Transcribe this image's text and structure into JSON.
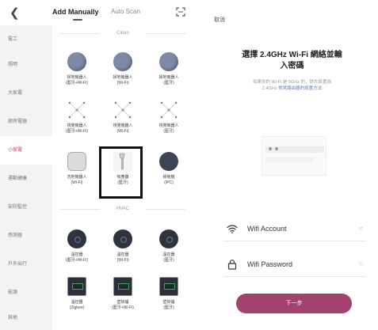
{
  "left": {
    "back_icon": "chevron-left-icon",
    "tabs": [
      {
        "label": "Add Manually",
        "active": true
      },
      {
        "label": "Auto Scan",
        "active": false
      }
    ],
    "scan_icon": "scan-frame-icon",
    "sidebar": [
      "電工",
      "照明",
      "大家電",
      "廚房電器",
      "小家電",
      "運動健康",
      "安防監控",
      "感測器",
      "戶外出行",
      "能源",
      "其他"
    ],
    "active_sidebar_index": 4,
    "sections": [
      {
        "title": "Clean",
        "devices": [
          {
            "label": "掃地機器人\n(藍牙+Wi-Fi)",
            "icon": "robot-vacuum-icon"
          },
          {
            "label": "掃地機器人\n(Wi-Fi)",
            "icon": "robot-vacuum-icon"
          },
          {
            "label": "掃地機器人\n(藍牙)",
            "icon": "robot-vacuum-icon"
          },
          {
            "label": "視覺機器人\n(藍牙+Wi-Fi)",
            "icon": "vision-robot-icon"
          },
          {
            "label": "視覺機器人\n(Wi-Fi)",
            "icon": "vision-robot-icon"
          },
          {
            "label": "視覺機器人\n(藍牙)",
            "icon": "vision-robot-icon"
          },
          {
            "label": "洗地機器人\n(Wi-Fi)",
            "icon": "mop-robot-icon"
          },
          {
            "label": "吸塵器\n(藍牙)",
            "icon": "handheld-vacuum-icon",
            "highlighted": true
          },
          {
            "label": "掃拖機\n(IPC)",
            "icon": "robot-vacuum-icon"
          }
        ]
      },
      {
        "title": "HVAC",
        "devices": [
          {
            "label": "溫控器\n(藍牙+Wi-Fi)",
            "icon": "thermostat-icon"
          },
          {
            "label": "溫控器\n(Wi-Fi)",
            "icon": "thermostat-icon"
          },
          {
            "label": "溫控器\n(藍牙)",
            "icon": "thermostat-icon"
          },
          {
            "label": "溫控器\n(Zigbee)",
            "icon": "thermostat-display-icon"
          },
          {
            "label": "壁掛爐\n(藍牙+Wi-Fi)",
            "icon": "thermostat-display-icon"
          },
          {
            "label": "壁掛爐\n(藍牙)",
            "icon": "thermostat-display-icon"
          }
        ]
      }
    ]
  },
  "right": {
    "cancel_label": "取消",
    "title_line1": "選擇 2.4GHz Wi-Fi 網絡並輸",
    "title_line2": "入密碼",
    "hint_text": "如果你的 Wi-Fi 是 5GHz 的，請先設置為",
    "hint_text_2": "2.4GHz",
    "hint_link": "常見路由器的設置方法",
    "illustration_icon": "router-settings-illustration",
    "fields": [
      {
        "label": "Wifi Account",
        "icon": "wifi-icon",
        "trailing_icon": "swap-icon"
      },
      {
        "label": "Wifi Password",
        "icon": "lock-icon",
        "trailing_icon": "eye-icon"
      }
    ],
    "next_label": "下一步",
    "accent_color": "#a3426f"
  }
}
